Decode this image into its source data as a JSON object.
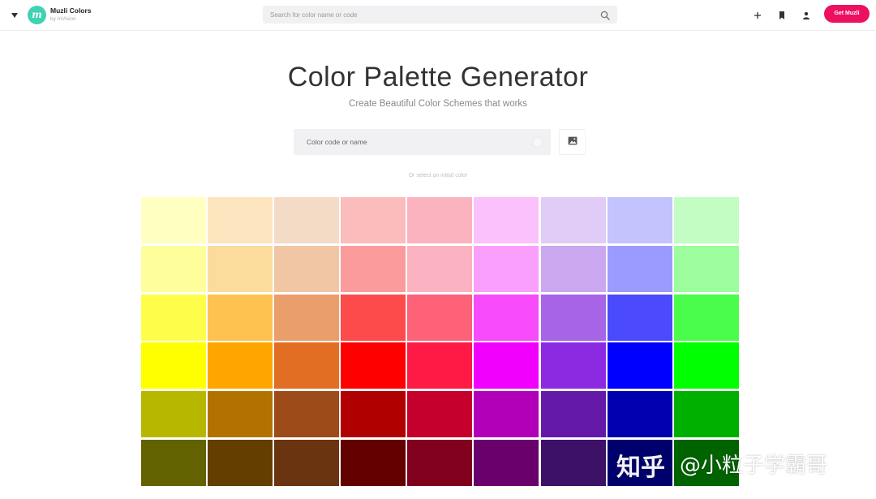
{
  "header": {
    "brand_logo_letter": "m",
    "brand_name": "Muzli Colors",
    "brand_sub": "by InVision",
    "search_placeholder": "Search for color name or code",
    "cta_label": "Get Muzli"
  },
  "hero": {
    "title": "Color Palette Generator",
    "subtitle": "Create Beautiful Color Schemes that works",
    "input_placeholder": "Color code or name",
    "hint": "Or select an initial color"
  },
  "palette": {
    "rows": [
      [
        "#ffffc2",
        "#fde5c0",
        "#f3dbc6",
        "#fbbcbc",
        "#fbb3bf",
        "#fbc1fd",
        "#e0ccf6",
        "#c3c3fd",
        "#c3fdc3"
      ],
      [
        "#fefe9b",
        "#fcdc9d",
        "#f0c6a4",
        "#fb9b9b",
        "#fbb3c2",
        "#fa9ffb",
        "#cba7ef",
        "#9b9bfd",
        "#9cfd9c"
      ],
      [
        "#fefe4a",
        "#fdc250",
        "#ea9e6c",
        "#fd4b4b",
        "#fe6279",
        "#f74bfc",
        "#a764e7",
        "#4b4bfd",
        "#4bfd4b"
      ],
      [
        "#ffff00",
        "#ffa500",
        "#e26e24",
        "#ff0000",
        "#fe1a44",
        "#f200fe",
        "#8c2ae1",
        "#0000ff",
        "#00ff00"
      ],
      [
        "#b8b700",
        "#b37200",
        "#9c4b19",
        "#b10000",
        "#c6002c",
        "#b100b8",
        "#6519a8",
        "#0000b0",
        "#00b000"
      ],
      [
        "#636200",
        "#633e00",
        "#6a3410",
        "#630000",
        "#80001d",
        "#6a006c",
        "#3e1168",
        "#00006c",
        "#006300"
      ]
    ]
  },
  "watermark": {
    "text1": "知乎",
    "text2": "@小粒子学霸哥"
  },
  "colors": {
    "accent": "#eb1060",
    "logo_bg": "#3ed3b3"
  }
}
